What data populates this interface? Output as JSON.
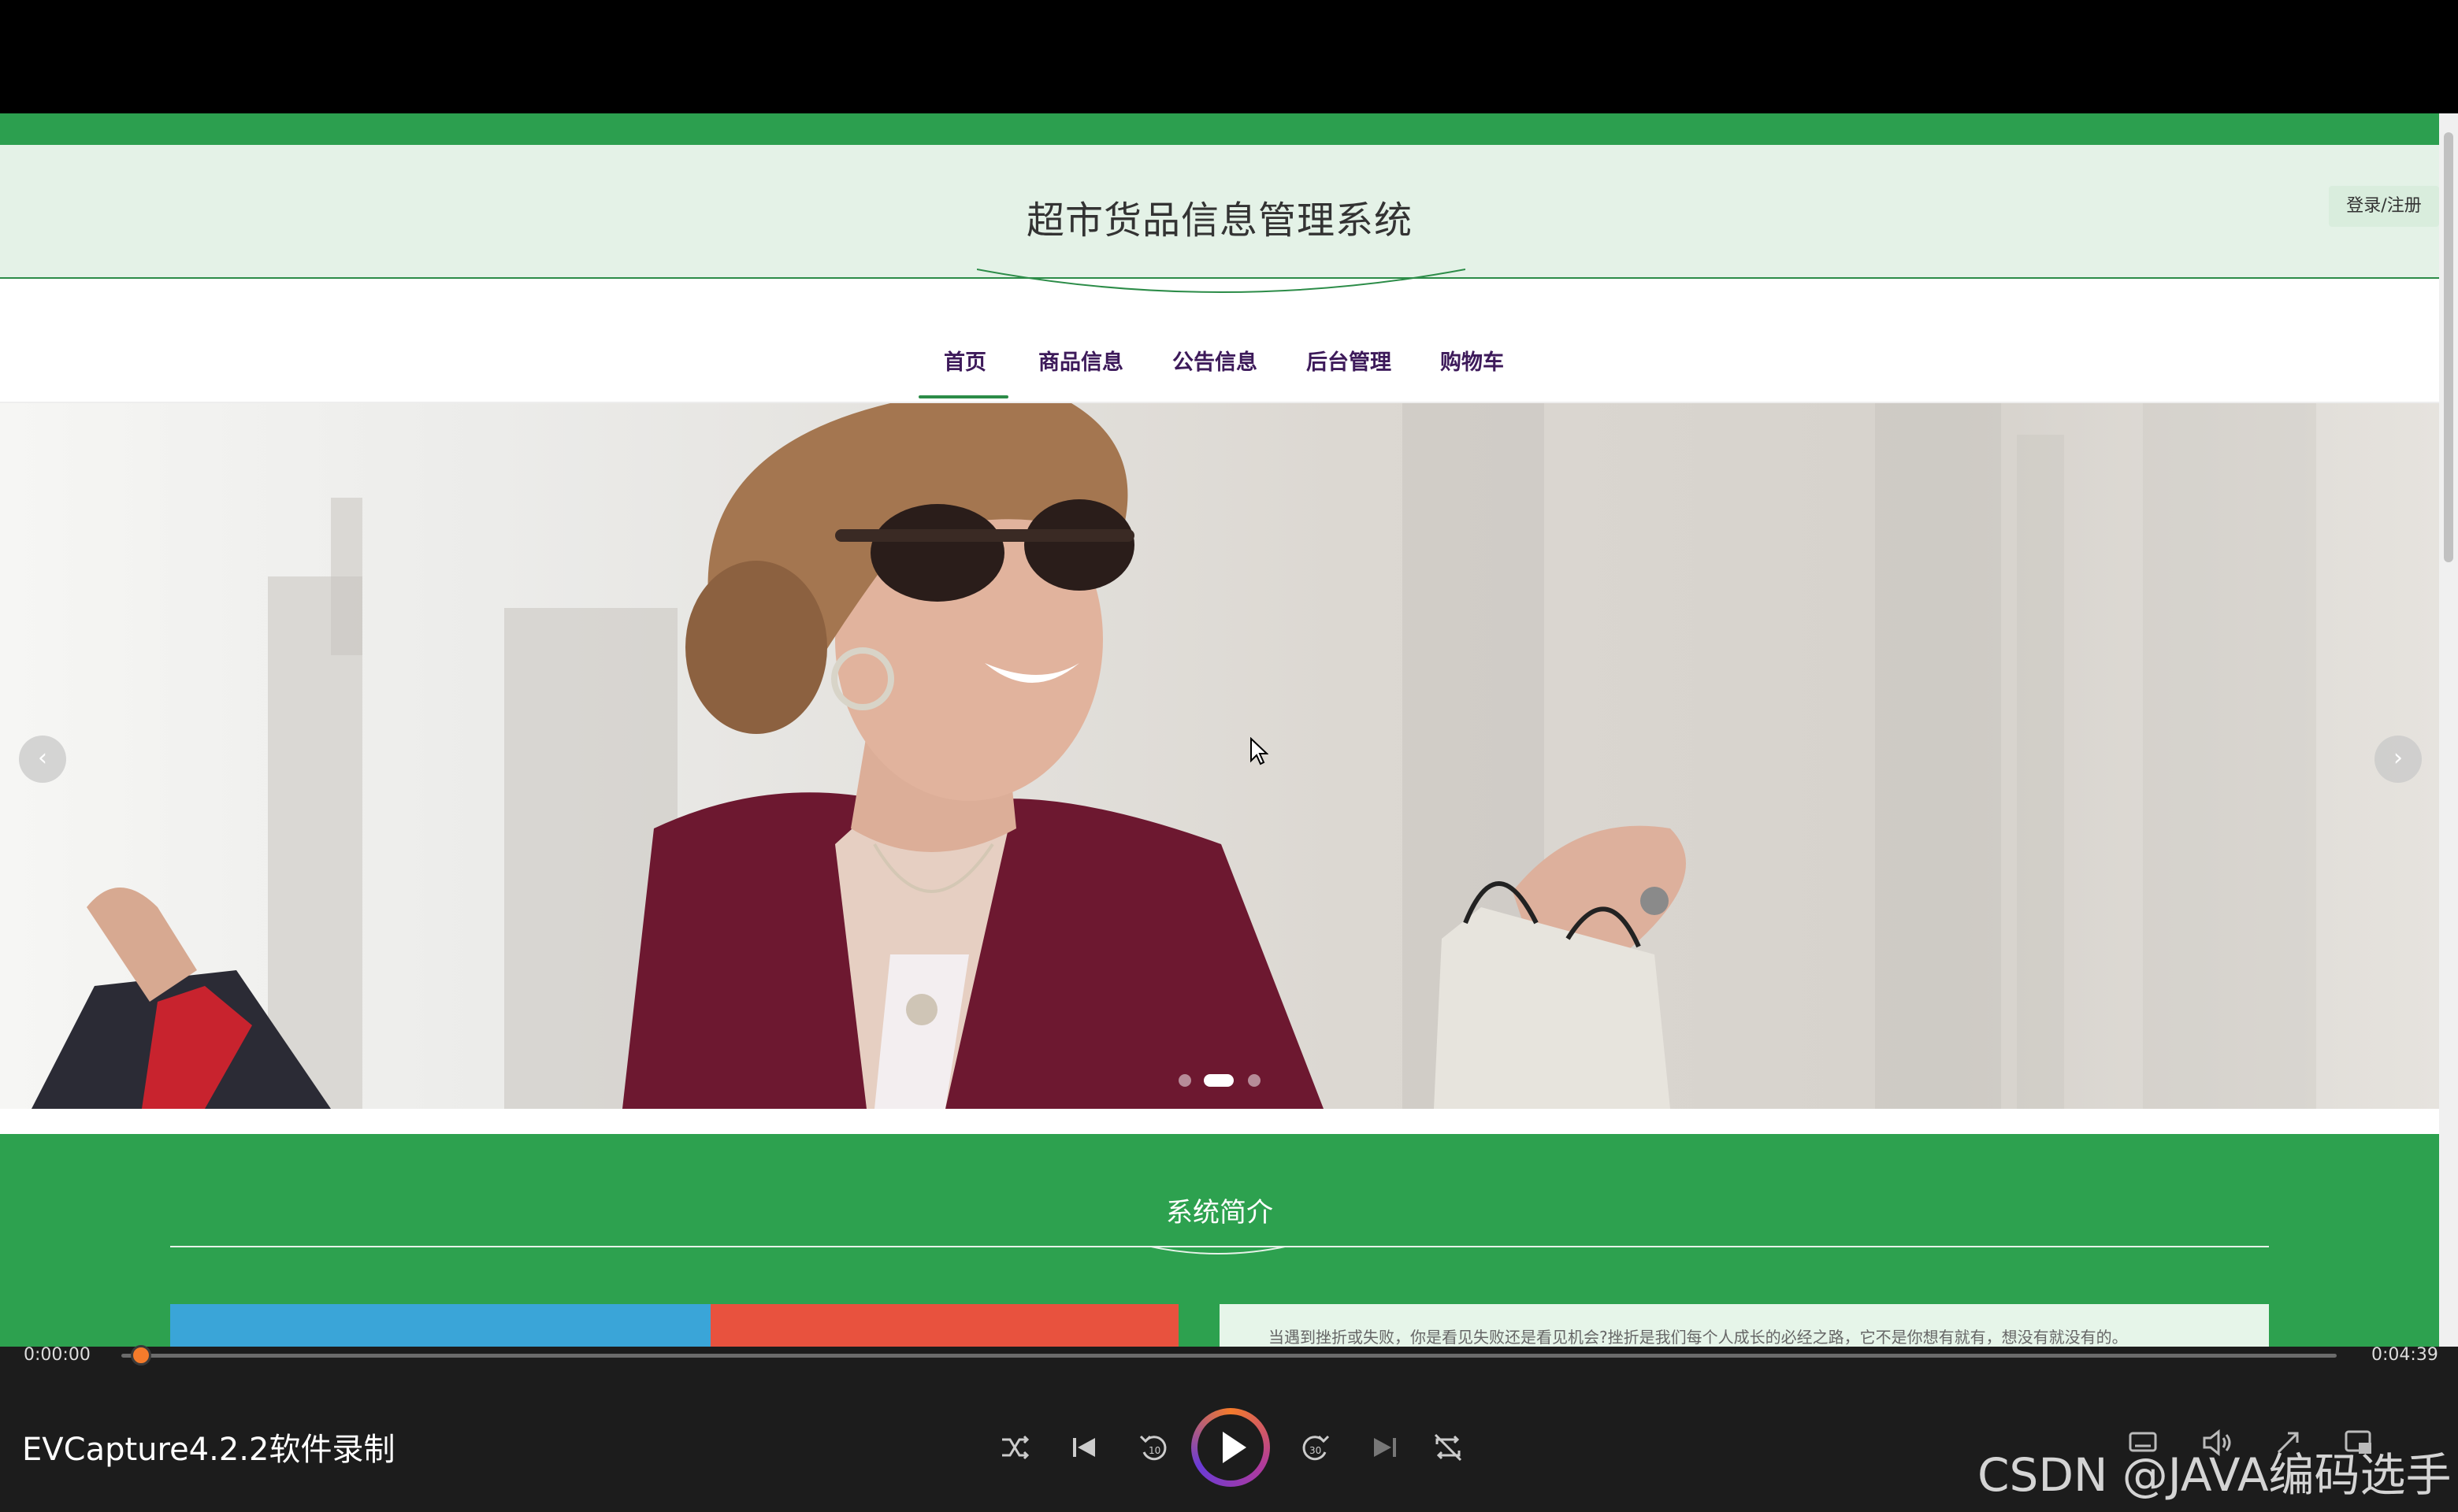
{
  "header": {
    "site_title": "超市货品信息管理系统",
    "login_label": "登录/注册"
  },
  "nav": {
    "items": [
      {
        "label": "首页",
        "active": true
      },
      {
        "label": "商品信息"
      },
      {
        "label": "公告信息"
      },
      {
        "label": "后台管理"
      },
      {
        "label": "购物车"
      }
    ]
  },
  "banner": {
    "slide_count": 3,
    "active_slide": 2,
    "prev_icon": "chevron-left-icon",
    "next_icon": "chevron-right-icon"
  },
  "intro": {
    "title": "系统简介",
    "text": "当遇到挫折或失败，你是看见失败还是看见机会?挫折是我们每个人成长的必经之路，它不是你想有就有，想没有就没有的。"
  },
  "player": {
    "time_current": "0:00:00",
    "time_total": "0:04:39",
    "progress": 0.0,
    "title": "EVCapture4.2.2软件录制",
    "watermark": "CSDN @JAVA编码选手"
  },
  "colors": {
    "brand_green": "#2c9f4f",
    "header_bg": "#e4f2e7",
    "nav_text": "#3d1a5a",
    "player_accent": "#f47b2b"
  }
}
